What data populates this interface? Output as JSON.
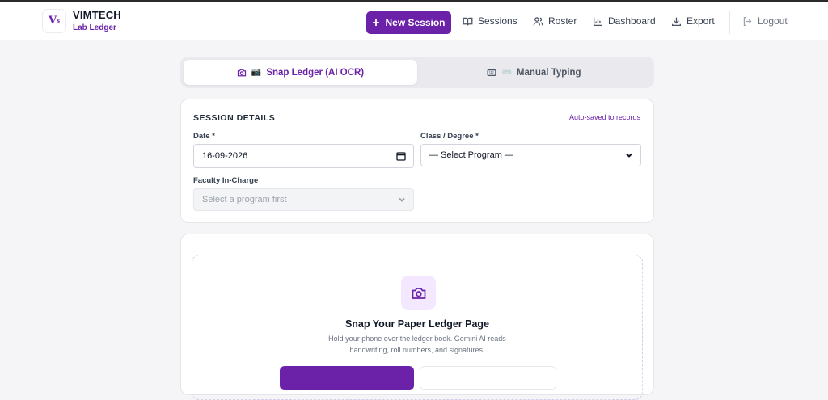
{
  "brand": {
    "logo_text": "V",
    "title": "VIMTECH",
    "subtitle": "Lab Ledger"
  },
  "nav": {
    "new_session": "New Session",
    "sessions": "Sessions",
    "roster": "Roster",
    "dashboard": "Dashboard",
    "export": "Export",
    "logout": "Logout"
  },
  "tabs": [
    {
      "label": "Snap Ledger (AI OCR)",
      "emoji": "📷",
      "active": true
    },
    {
      "label": "Manual Typing",
      "emoji": "⌨️",
      "active": false
    }
  ],
  "session": {
    "title": "SESSION DETAILS",
    "autosave": "Auto-saved to records",
    "date_label": "Date *",
    "date_value": "16-09-2026",
    "class_label": "Class / Degree *",
    "class_value": "— Select Program —",
    "faculty_label": "Faculty In-Charge",
    "faculty_placeholder": "Select a program first"
  },
  "upload": {
    "title": "Snap Your Paper Ledger Page",
    "description": "Hold your phone over the ledger book. Gemini AI reads handwriting, roll numbers, and signatures."
  },
  "colors": {
    "accent": "#6b21a8",
    "accent_light": "#f3e8ff"
  },
  "icons": [
    "camera-icon",
    "keyboard-icon",
    "plus-icon",
    "book-icon",
    "users-icon",
    "bar-chart-icon",
    "download-icon",
    "logout-icon",
    "calendar-icon",
    "chevron-down-icon"
  ]
}
